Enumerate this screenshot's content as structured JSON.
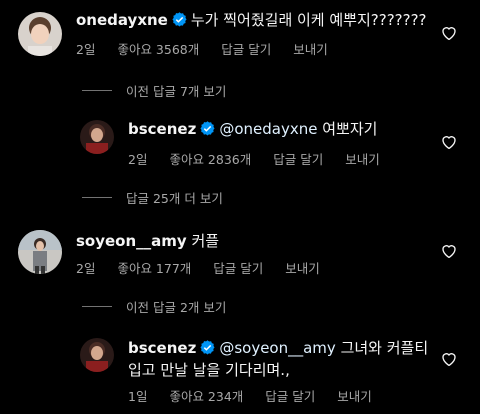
{
  "comments": [
    {
      "username": "onedayxne",
      "mention": "",
      "text_lines": [
        "누가 찍어줬길래 이케 예뿌지???????"
      ],
      "time": "2일",
      "likes": "좋아요 3568개",
      "reply": "답글 달기",
      "send": "보내기",
      "verified": true
    },
    {
      "username": "bscenez",
      "mention": "@onedayxne",
      "text_lines": [
        "여뽀자기"
      ],
      "time": "2일",
      "likes": "좋아요 2836개",
      "reply": "답글 달기",
      "send": "보내기",
      "verified": true
    },
    {
      "username": "soyeon__amy",
      "mention": "",
      "text_lines": [
        "커플"
      ],
      "time": "2일",
      "likes": "좋아요 177개",
      "reply": "답글 달기",
      "send": "보내기",
      "verified": false
    },
    {
      "username": "bscenez",
      "mention": "@soyeon__amy",
      "text_lines": [
        "그녀와 커플티",
        "입고 만날 날을 기다리며.,"
      ],
      "time": "1일",
      "likes": "좋아요 234개",
      "reply": "답글 달기",
      "send": "보내기",
      "verified": true
    }
  ],
  "view_replies": [
    "이전 답글 7개 보기",
    "답글 25개 더 보기",
    "이전 답글 2개 보기"
  ],
  "colors": {
    "background": "#000000",
    "text": "#f5f5f5",
    "secondary": "#a8a8a8",
    "verified": "#0095f6"
  }
}
